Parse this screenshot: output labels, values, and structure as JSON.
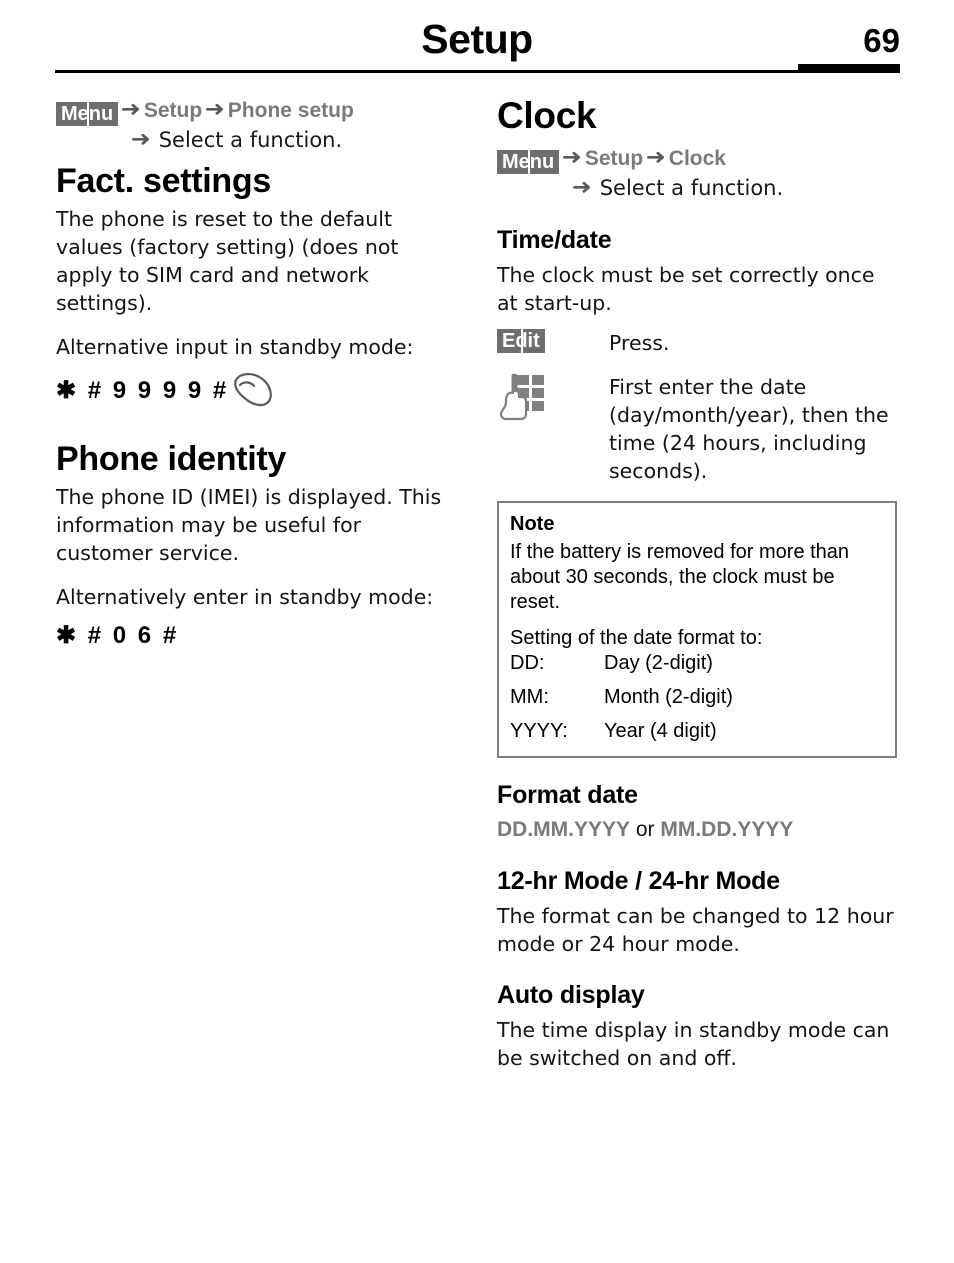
{
  "header": {
    "title": "Setup",
    "page_number": "69"
  },
  "left_column": {
    "menu_path": {
      "badge": "Menu",
      "arrow": "➜",
      "steps": [
        "Setup",
        "Phone setup"
      ],
      "second_line": "Select a function."
    },
    "sections": [
      {
        "heading": "Fact. settings",
        "paragraphs": [
          "The phone is reset to the default values (factory setting) (does not apply to SIM card and network settings).",
          "Alternative input in standby mode:"
        ],
        "code": "✱ # 9 9 9 9 #",
        "code_icon": "handset-icon"
      },
      {
        "heading": "Phone identity",
        "paragraphs": [
          "The phone ID (IMEI) is displayed. This information may be useful for customer service.",
          "Alternatively enter in standby mode:"
        ],
        "code": "✱ # 0 6 #",
        "code_icon": null
      }
    ]
  },
  "right_column": {
    "title": "Clock",
    "menu_path": {
      "badge": "Menu",
      "arrow": "➜",
      "steps": [
        "Setup",
        "Clock"
      ],
      "second_line": "Select a function."
    },
    "time_date": {
      "heading": "Time/date",
      "intro": "The clock must be set correctly once at start-up.",
      "steps": [
        {
          "icon": "edit-softkey-badge",
          "label": "Edit",
          "text": "Press."
        },
        {
          "icon": "keypad-hand-icon",
          "label": "",
          "text": "First enter the date (day/month/year), then the time (24 hours, including seconds)."
        }
      ]
    },
    "note": {
      "heading": "Note",
      "paragraph": "If the battery is removed for more than about 30 seconds, the clock must be reset.",
      "format_intro": "Setting of the date format to:",
      "rows": [
        {
          "key": "DD:",
          "value": "Day (2-digit)"
        },
        {
          "key": "MM:",
          "value": "Month (2-digit)"
        },
        {
          "key": "YYYY:",
          "value": "Year (4 digit)"
        }
      ]
    },
    "format_date": {
      "heading": "Format date",
      "option_a": "DD.MM.YYYY",
      "separator": " or ",
      "option_b": "MM.DD.YYYY"
    },
    "hr_mode": {
      "heading": "12-hr Mode / 24-hr Mode",
      "text": "The format can be changed to 12 hour mode or 24 hour mode."
    },
    "auto_display": {
      "heading": "Auto display",
      "text": "The time display in standby mode can be switched on and off."
    }
  },
  "colors": {
    "badge_bg": "#6e6e6e",
    "path_text": "#7a7a7a",
    "note_border": "#808080",
    "rule": "#000000"
  }
}
